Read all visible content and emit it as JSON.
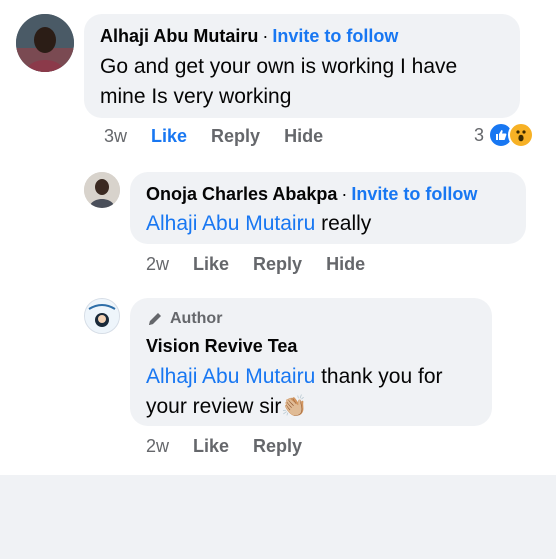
{
  "comments": [
    {
      "author": "Alhaji Abu Mutairu",
      "invite_label": "Invite to follow",
      "text_line1": "Go and get your  own is working  I have",
      "text_line2": "mine Is very  working",
      "time": "3w",
      "like_label": "Like",
      "reply_label": "Reply",
      "hide_label": "Hide",
      "reaction_count": "3",
      "avatar_icon": "profile-photo",
      "reaction_icons": [
        "like-icon",
        "wow-icon"
      ]
    },
    {
      "author": "Onoja Charles Abakpa",
      "invite_label": "Invite to follow",
      "mention": "Alhaji Abu Mutairu",
      "text": " really",
      "time": "2w",
      "like_label": "Like",
      "reply_label": "Reply",
      "hide_label": "Hide",
      "avatar_icon": "profile-photo"
    },
    {
      "author_tag": "Author",
      "author": "Vision Revive Tea",
      "mention": "Alhaji Abu Mutairu",
      "text_line1": " thank you for",
      "text_line2": "your review sir",
      "emoji": "👏🏼",
      "time": "2w",
      "like_label": "Like",
      "reply_label": "Reply",
      "avatar_icon": "page-logo",
      "author_tag_icon": "pencil-icon"
    }
  ],
  "colors": {
    "link": "#1877f2",
    "bubble": "#f0f2f5",
    "secondary_text": "#65676b",
    "wow": "#f7b125"
  }
}
